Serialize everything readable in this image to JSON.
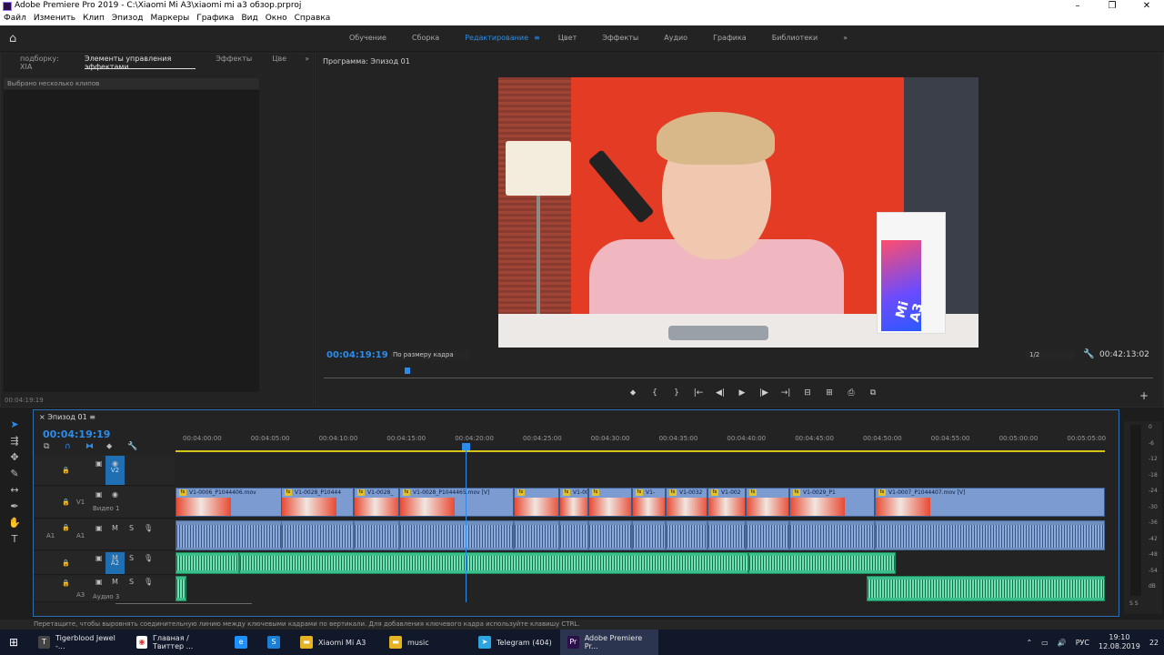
{
  "window": {
    "title": "Adobe Premiere Pro 2019 - C:\\Xiaomi Mi A3\\xiaomi mi a3 обзор.prproj",
    "controls": [
      "–",
      "❐",
      "✕"
    ]
  },
  "menu": [
    "Файл",
    "Изменить",
    "Клип",
    "Эпизод",
    "Маркеры",
    "Графика",
    "Вид",
    "Окно",
    "Справка"
  ],
  "workspaces": {
    "items": [
      "Обучение",
      "Сборка",
      "Редактирование",
      "Цвет",
      "Эффекты",
      "Аудио",
      "Графика",
      "Библиотеки"
    ],
    "active": "Редактирование",
    "more": "»"
  },
  "left_panel": {
    "tabs": [
      "подборку: XIA",
      "Элементы управления эффектами",
      "Эффекты",
      "Цве"
    ],
    "active_tab": "Элементы управления эффектами",
    "selection_text": "Выбрано несколько клипов",
    "timecode": "00:04:19:19"
  },
  "program": {
    "title": "Программа: Эпизод 01",
    "timecode": "00:04:19:19",
    "fit": "По размеру кадра",
    "resolution": "1/2",
    "duration": "00:42:13:02",
    "video_text": "Mi A3"
  },
  "transport": [
    "⬥",
    "{",
    "}",
    "|←",
    "◀|",
    "▶",
    "|▶",
    "→|",
    "⊟",
    "⊞",
    "⎙",
    "⧉"
  ],
  "timeline": {
    "tab": "Эпизод 01",
    "timecode": "00:04:19:19",
    "ruler_ticks": [
      "00:04:00:00",
      "00:04:05:00",
      "00:04:10:00",
      "00:04:15:00",
      "00:04:20:00",
      "00:04:25:00",
      "00:04:30:00",
      "00:04:35:00",
      "00:04:40:00",
      "00:04:45:00",
      "00:04:50:00",
      "00:04:55:00",
      "00:05:00:00",
      "00:05:05:00"
    ],
    "tracks": {
      "v2": "V2",
      "v1": "V1",
      "v1_name": "Видео 1",
      "a1": "A1",
      "a2": "A2",
      "a3": "A3",
      "a3_name": "Аудио 3",
      "m": "M",
      "s": "S"
    },
    "clips": [
      "V1-0006_P1044406.mov",
      "V1-0028_P10444",
      "V1-0028_",
      "V1-0028_P1044465.mov [V]",
      "V1-0032",
      "V1-",
      "V1-0032",
      "V1-002",
      "V1-0029_P1",
      "V1-0007_P1044407.mov [V]"
    ]
  },
  "meters": {
    "labels": [
      "0",
      "-6",
      "-12",
      "-18",
      "-24",
      "-30",
      "-36",
      "-42",
      "-48",
      "-54",
      "dB"
    ],
    "solo": "S  S"
  },
  "status_text": "Перетащите, чтобы выровнять соединительную линию между ключевыми кадрами по вертикали. Для добавления ключевого кадра используйте клавишу CTRL.",
  "taskbar": {
    "items": [
      {
        "label": "Tigerblood Jewel -...",
        "icon": "T"
      },
      {
        "label": "Главная / Твиттер ...",
        "icon": "◉"
      },
      {
        "label": "",
        "icon": "e"
      },
      {
        "label": "",
        "icon": "S"
      },
      {
        "label": "Xiaomi Mi A3",
        "icon": "▬"
      },
      {
        "label": "music",
        "icon": "▬"
      },
      {
        "label": "Telegram (404)",
        "icon": "➤"
      },
      {
        "label": "Adobe Premiere Pr...",
        "icon": "Pr"
      }
    ],
    "lang": "РУС",
    "time": "19:10",
    "date": "12.08.2019",
    "notif": "22"
  }
}
